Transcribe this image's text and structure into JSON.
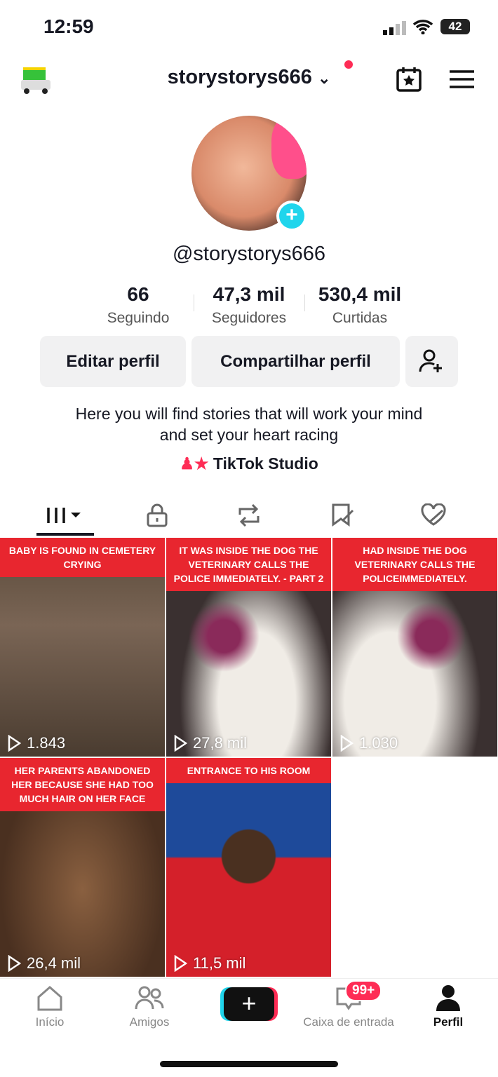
{
  "status": {
    "time": "12:59",
    "battery": "42"
  },
  "header": {
    "username": "storystorys666"
  },
  "profile": {
    "handle": "@storystorys666",
    "stats": [
      {
        "value": "66",
        "label": "Seguindo"
      },
      {
        "value": "47,3 mil",
        "label": "Seguidores"
      },
      {
        "value": "530,4 mil",
        "label": "Curtidas"
      }
    ],
    "edit_label": "Editar perfil",
    "share_label": "Compartilhar perfil",
    "bio_line1": "Here you will find stories that will work your mind",
    "bio_line2": "and set your heart racing",
    "studio_label": "TikTok Studio"
  },
  "videos": [
    {
      "caption": "BABY IS FOUND IN CEMETERY CRYING",
      "views": "1.843",
      "bg": "linear-gradient(#5a4a3a,#7a6555 40%,#4a3c30)"
    },
    {
      "caption": "IT WAS INSIDE THE DOG THE VETERINARY CALLS THE POLICE IMMEDIATELY. - PART 2",
      "views": "27,8 mil",
      "bg": "radial-gradient(circle at 35% 45%,#8a2a5a 10%,transparent 22%),radial-gradient(ellipse at 55% 75%,#f0ece6 30%,#3a3030 60%)"
    },
    {
      "caption": "HAD INSIDE THE DOG VETERINARY CALLS THE POLICEIMMEDIATELY.",
      "views": "1.030",
      "bg": "radial-gradient(circle at 60% 45%,#8a2a5a 10%,transparent 22%),radial-gradient(ellipse at 35% 75%,#f0ece6 30%,#3a3030 60%)"
    },
    {
      "caption": "HER PARENTS ABANDONED HER BECAUSE SHE HAD TOO MUCH HAIR ON HER FACE",
      "views": "26,4 mil",
      "bg": "radial-gradient(ellipse at 50% 60%,#8a6040,#4a3020 70%)"
    },
    {
      "caption": "ENTRANCE TO HIS ROOM",
      "views": "11,5 mil",
      "bg": "radial-gradient(circle at 50% 45%,#4a3020 18%,transparent 19%),linear-gradient(#1e4a9a 45%,#d4202a 46%)"
    }
  ],
  "nav": [
    {
      "label": "Início"
    },
    {
      "label": "Amigos"
    },
    {
      "label": ""
    },
    {
      "label": "Caixa de entrada",
      "badge": "99+"
    },
    {
      "label": "Perfil"
    }
  ],
  "colors": {
    "accent": "#fe2c55",
    "cyan": "#20d5ec"
  }
}
